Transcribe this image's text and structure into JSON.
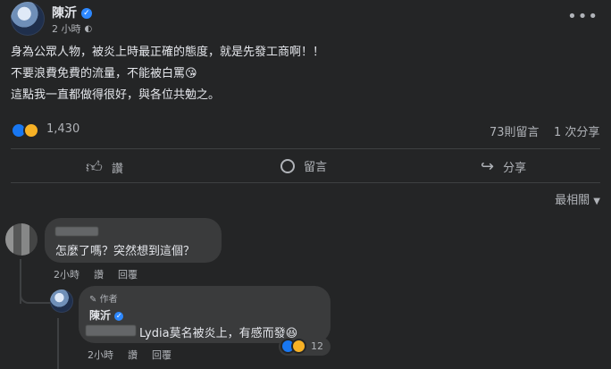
{
  "post": {
    "author": "陳沂",
    "time": "2 小時",
    "lines": [
      "身為公眾人物，被炎上時最正確的態度，就是先發工商啊！！",
      "不要浪費免費的流量，不能被白罵",
      "這點我一直都做得很好，與各位共勉之。"
    ],
    "emoji_line2": "😘",
    "reactions_count": "1,430",
    "comments_count": "73則留言",
    "shares_count": "1 次分享"
  },
  "actions": {
    "like": "讚",
    "comment": "留言",
    "share": "分享"
  },
  "sort": {
    "label": "最相關"
  },
  "comments": [
    {
      "text": "怎麼了嗎？突然想到這個？",
      "time": "2小時",
      "like": "讚",
      "reply": "回覆"
    },
    {
      "author_badge": "作者",
      "author": "陳沂",
      "text": "Lydia莫名被炎上，有感而發",
      "emoji": "😆",
      "reactions_count": "12",
      "time": "2小時",
      "like": "讚",
      "reply": "回覆"
    }
  ],
  "colors": {
    "bg": "#242526",
    "bubble": "#3a3b3c",
    "accent": "#2d88ff"
  }
}
